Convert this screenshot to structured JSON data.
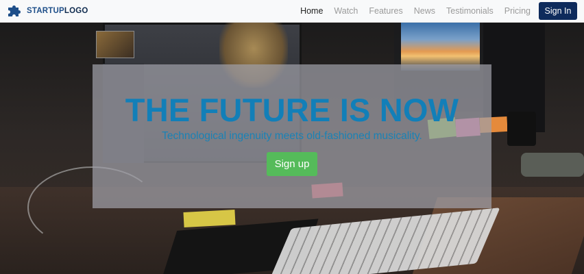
{
  "brand": {
    "logo_text_part1": "STARTUP",
    "logo_text_part2": "LOGO",
    "icon": "puzzle-piece-icon",
    "color": "#1d4e89"
  },
  "nav": {
    "items": [
      {
        "label": "Home",
        "active": true
      },
      {
        "label": "Watch",
        "active": false
      },
      {
        "label": "Features",
        "active": false
      },
      {
        "label": "News",
        "active": false
      },
      {
        "label": "Testimonials",
        "active": false
      },
      {
        "label": "Pricing",
        "active": false
      }
    ],
    "signin_label": "Sign In",
    "signin_color": "#0e2b5c"
  },
  "hero": {
    "headline": "THE FUTURE IS NOW",
    "tagline": "Technological ingenuity meets old-fashioned musicality.",
    "signup_label": "Sign up",
    "headline_color": "#127fb8",
    "signup_color": "#55bb5a"
  }
}
